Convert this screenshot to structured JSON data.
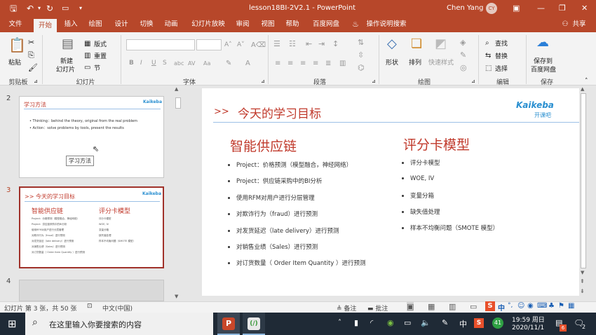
{
  "window": {
    "title": "lesson18BI-2V2.1  -  PowerPoint",
    "user": "Chen Yang",
    "user_initials": "CY"
  },
  "tabs": [
    "文件",
    "开始",
    "插入",
    "绘图",
    "设计",
    "切换",
    "动画",
    "幻灯片放映",
    "审阅",
    "视图",
    "帮助",
    "百度网盘",
    "操作说明搜索"
  ],
  "share_label": "共享",
  "ribbon": {
    "paste": "粘贴",
    "clipboard": "剪贴板",
    "new_slide": "新建",
    "new_slide2": "幻灯片",
    "layout": "版式",
    "reset": "重置",
    "section": "节",
    "slides_group": "幻灯片",
    "font_group": "字体",
    "para_group": "段落",
    "shape": "形状",
    "arrange": "排列",
    "quick_style": "快速样式",
    "drawing_group": "绘图",
    "find": "查找",
    "replace": "替换",
    "select": "选择",
    "edit_group": "编辑",
    "save_to": "保存到",
    "baidu": "百度网盘",
    "save_group": "保存"
  },
  "thumbs": [
    {
      "num": "2",
      "title": "学习方法",
      "lines": [
        "• Thinking：behind the theory, original from the real problem",
        "• Action：solve problems by tools, present the results"
      ],
      "caption": "学习方法"
    },
    {
      "num": "3",
      "title": "今天的学习目标",
      "left_h": "智能供应链",
      "right_h": "评分卡模型"
    },
    {
      "num": "4"
    }
  ],
  "slide": {
    "arrow": ">>",
    "title": "今天的学习目标",
    "logo_text": "Kaikeba",
    "logo_sub": "开课吧",
    "left_heading": "智能供应链",
    "left_items": [
      "Project：价格预测（模型融合，神经网络）",
      "Project：供应链采购中的BI分析",
      "使用RFM对用户进行分层管理",
      "对欺诈行为（fraud）进行预测",
      "对发货延迟（late delivery）进行预测",
      "对销售业绩（Sales）进行预测",
      "对订货数量（ Order Item Quantity ）进行预测"
    ],
    "right_heading": "评分卡模型",
    "right_items": [
      "评分卡模型",
      "WOE, IV",
      "变量分箱",
      "缺失值处理",
      "样本不均衡问题（SMOTE 模型）"
    ]
  },
  "status": {
    "slide_info": "幻灯片 第 3 张，共 50 张",
    "lang": "中文(中国)",
    "notes": "备注",
    "comments": "批注",
    "ime": "中"
  },
  "taskbar": {
    "search_placeholder": "在这里输入你要搜索的内容",
    "time": "19:59 周日",
    "date": "2020/11/1",
    "ime": "中",
    "badge": "41",
    "notif": "2",
    "app1": "P"
  },
  "colors": {
    "accent": "#b7472a",
    "title_red": "#c0392b",
    "heading_red": "#c0392b"
  }
}
